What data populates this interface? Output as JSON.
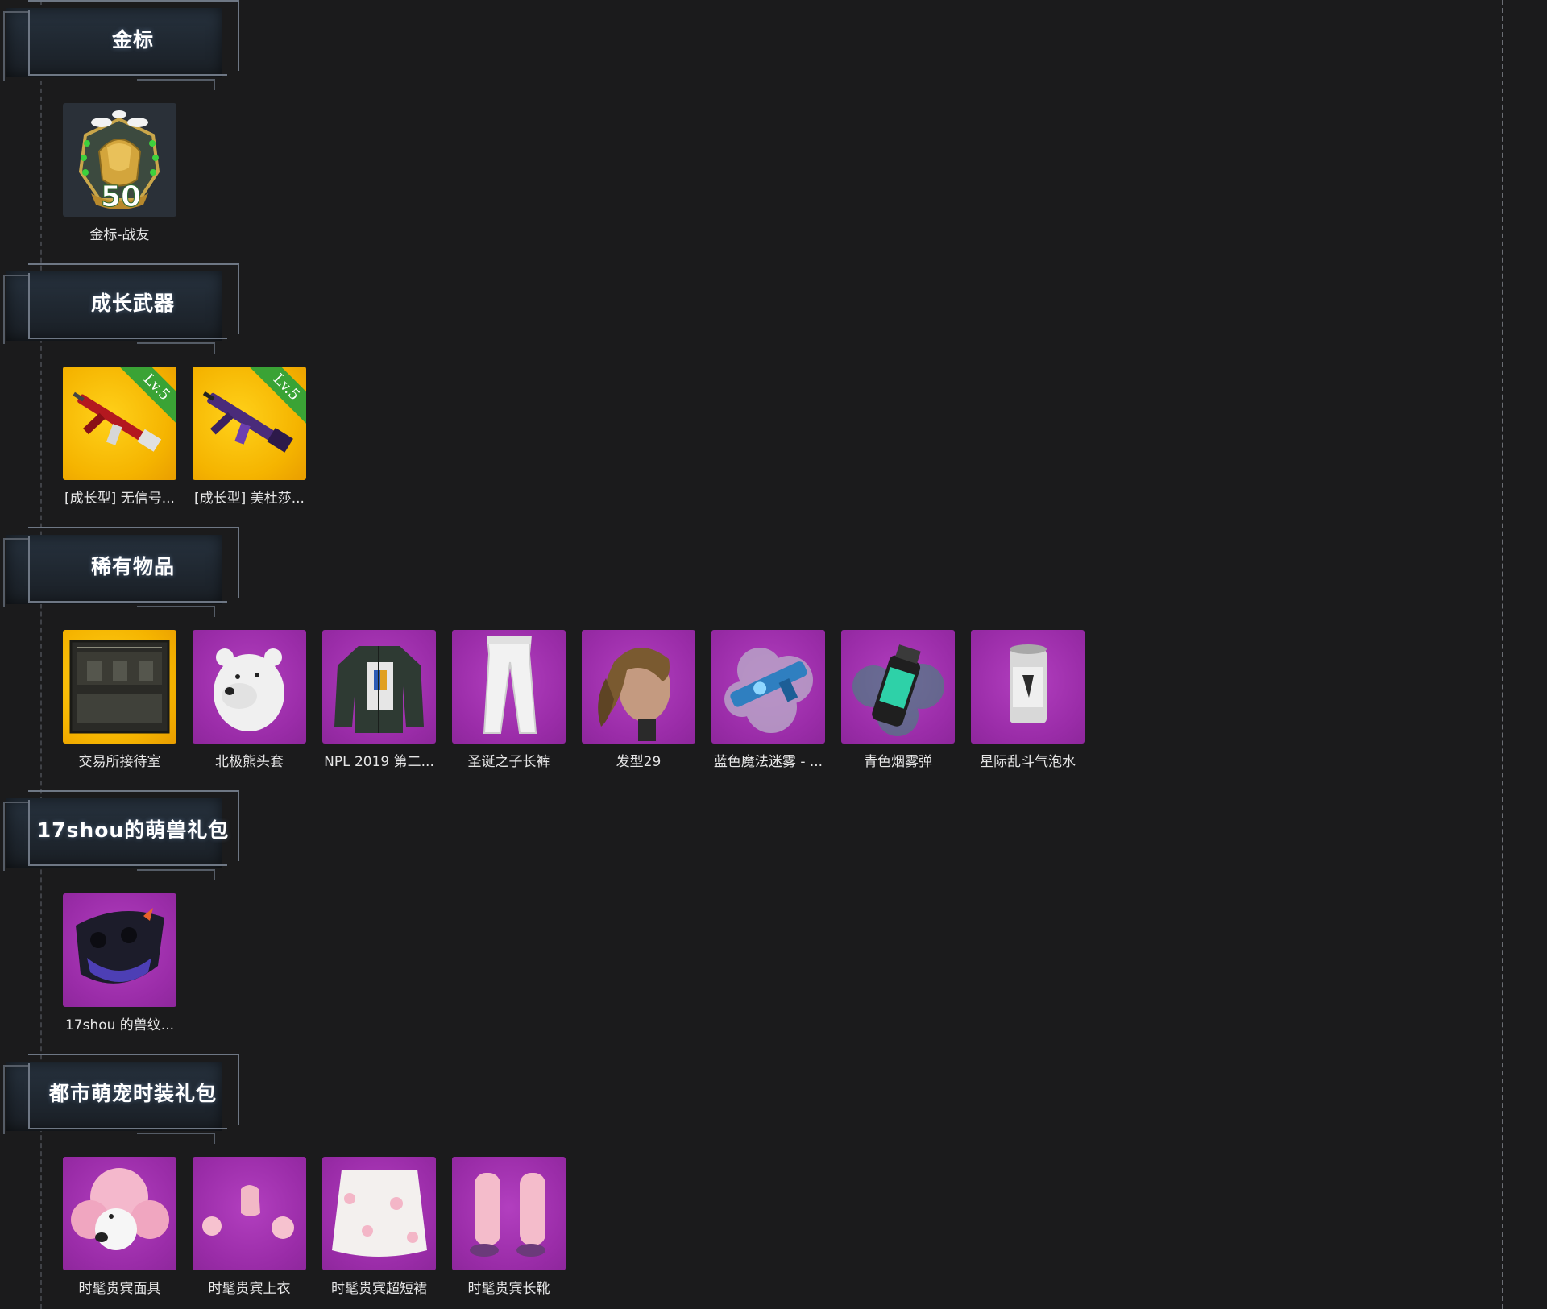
{
  "sections": [
    {
      "title": "金标",
      "items": [
        {
          "label": "金标-战友",
          "bg": "dark",
          "badge_number": "50"
        }
      ]
    },
    {
      "title": "成长武器",
      "items": [
        {
          "label": "[成长型] 无信号...",
          "bg": "gold",
          "level": "Lv.5"
        },
        {
          "label": "[成长型] 美杜莎...",
          "bg": "gold",
          "level": "Lv.5"
        }
      ]
    },
    {
      "title": "稀有物品",
      "items": [
        {
          "label": "交易所接待室",
          "bg": "gold"
        },
        {
          "label": "北极熊头套",
          "bg": "purple"
        },
        {
          "label": "NPL 2019 第二...",
          "bg": "purple"
        },
        {
          "label": "圣诞之子长裤",
          "bg": "purple"
        },
        {
          "label": "发型29",
          "bg": "purple"
        },
        {
          "label": "蓝色魔法迷雾 - ...",
          "bg": "purple"
        },
        {
          "label": "青色烟雾弹",
          "bg": "purple"
        },
        {
          "label": "星际乱斗气泡水",
          "bg": "purple"
        }
      ]
    },
    {
      "title": "17shou的萌兽礼包",
      "items": [
        {
          "label": "17shou 的兽纹...",
          "bg": "purple"
        }
      ]
    },
    {
      "title": "都市萌宠时装礼包",
      "items": [
        {
          "label": "时髦贵宾面具",
          "bg": "purple"
        },
        {
          "label": "时髦贵宾上衣",
          "bg": "purple"
        },
        {
          "label": "时髦贵宾超短裙",
          "bg": "purple"
        },
        {
          "label": "时髦贵宾长靴",
          "bg": "purple"
        }
      ]
    }
  ]
}
